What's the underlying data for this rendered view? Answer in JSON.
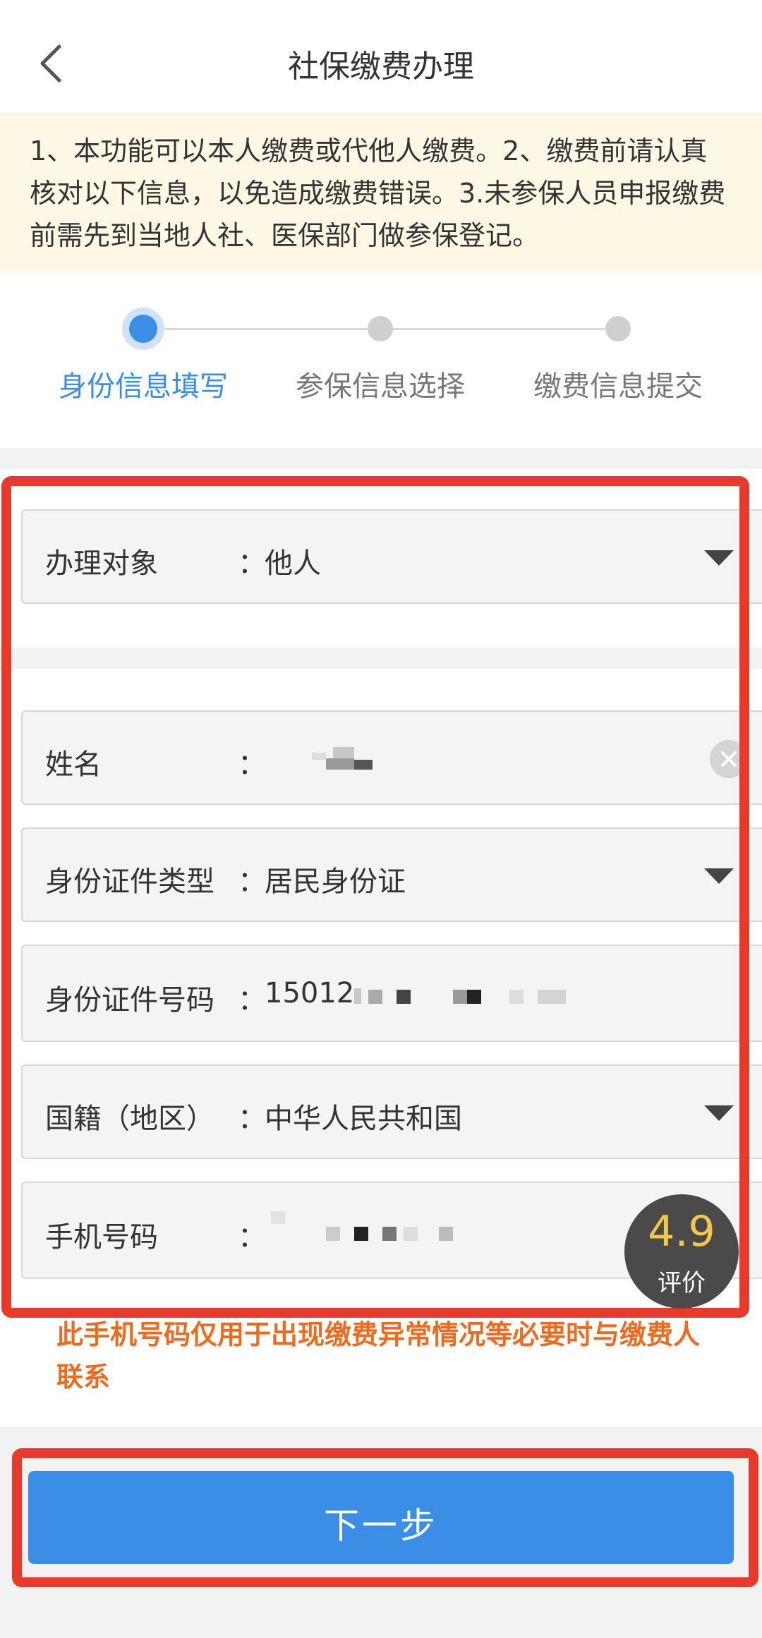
{
  "header": {
    "title": "社保缴费办理"
  },
  "notice": {
    "text": "1、本功能可以本人缴费或代他人缴费。2、缴费前请认真核对以下信息，以免造成缴费错误。3.未参保人员申报缴费前需先到当地人社、医保部门做参保登记。"
  },
  "steps": [
    {
      "label": "身份信息填写",
      "active": true
    },
    {
      "label": "参保信息选择",
      "active": false
    },
    {
      "label": "缴费信息提交",
      "active": false
    }
  ],
  "form": {
    "target": {
      "label": "办理对象",
      "colon": "：",
      "value": "他人"
    },
    "name": {
      "label": "姓名",
      "colon": "：",
      "value": ""
    },
    "id_type": {
      "label": "身份证件类型",
      "colon": "：",
      "value": "居民身份证"
    },
    "id_number": {
      "label": "身份证件号码",
      "colon": "：",
      "value": "15012"
    },
    "nationality": {
      "label": "国籍（地区）",
      "colon": "：",
      "value": "中华人民共和国"
    },
    "phone": {
      "label": "手机号码",
      "colon": "：",
      "value": ""
    }
  },
  "hint": {
    "text": "此手机号码仅用于出现缴费异常情况等必要时与缴费人联系"
  },
  "rating": {
    "score": "4.9",
    "label": "评价"
  },
  "next_button": {
    "label": "下一步"
  },
  "colors": {
    "accent": "#3a8ee6",
    "notice_bg": "#fdf7e3",
    "hint": "#ee6a1c",
    "highlight_outline": "#e8392b"
  },
  "icons": [
    "back-arrow-icon",
    "chevron-down-icon",
    "clear-icon"
  ]
}
